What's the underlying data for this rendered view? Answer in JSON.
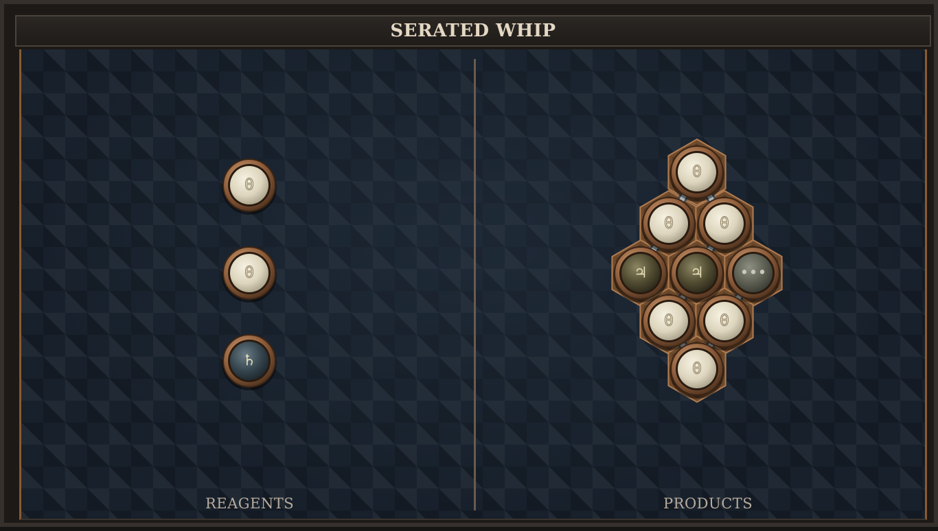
{
  "title": "SERATED WHIP",
  "reagents": {
    "label": "REAGENTS",
    "atoms": [
      {
        "icon": "salt-atom-icon",
        "symbol": "θ",
        "element": "salt"
      },
      {
        "icon": "salt-atom-icon",
        "symbol": "θ",
        "element": "salt"
      },
      {
        "icon": "lead-atom-icon",
        "symbol": "♄",
        "element": "lead"
      }
    ]
  },
  "products": {
    "label": "PRODUCTS",
    "atoms": [
      {
        "icon": "salt-atom-icon",
        "symbol": "θ",
        "element": "salt"
      },
      {
        "icon": "salt-atom-icon",
        "symbol": "θ",
        "element": "salt"
      },
      {
        "icon": "salt-atom-icon",
        "symbol": "θ",
        "element": "salt"
      },
      {
        "icon": "tin-atom-icon",
        "symbol": "♃",
        "element": "tin"
      },
      {
        "icon": "tin-atom-icon",
        "symbol": "♃",
        "element": "tin"
      },
      {
        "icon": "repeat-atom-icon",
        "symbol": "•••",
        "element": "repeat"
      },
      {
        "icon": "salt-atom-icon",
        "symbol": "θ",
        "element": "salt"
      },
      {
        "icon": "salt-atom-icon",
        "symbol": "θ",
        "element": "salt"
      },
      {
        "icon": "salt-atom-icon",
        "symbol": "θ",
        "element": "salt"
      }
    ]
  },
  "colors": {
    "salt": "#e3dcc6",
    "lead": "#3c4c56",
    "tin": "#5a5436",
    "repeat": "#6a6c5e",
    "bronze": "#9b6a44",
    "board": "#17202b"
  }
}
